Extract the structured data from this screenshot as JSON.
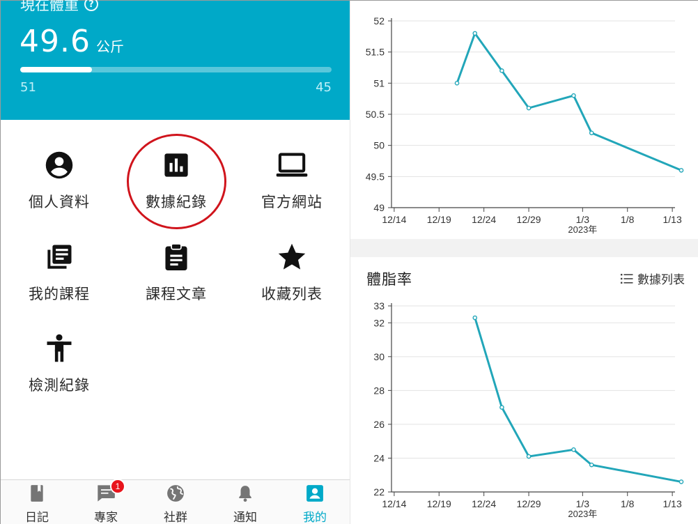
{
  "weight_card": {
    "title": "現在體重",
    "value": "49.6",
    "unit": "公斤",
    "start_value": "51",
    "goal_value": "45",
    "progress_fraction": 0.23
  },
  "menu": {
    "items": [
      {
        "label": "個人資料",
        "icon": "account-circle-icon"
      },
      {
        "label": "數據紀錄",
        "icon": "bar-chart-icon"
      },
      {
        "label": "官方網站",
        "icon": "laptop-icon"
      },
      {
        "label": "我的課程",
        "icon": "library-books-icon"
      },
      {
        "label": "課程文章",
        "icon": "clipboard-icon"
      },
      {
        "label": "收藏列表",
        "icon": "star-icon"
      },
      {
        "label": "檢測紀錄",
        "icon": "accessibility-icon"
      }
    ]
  },
  "tabbar": {
    "tabs": [
      {
        "label": "日記",
        "icon": "book-icon"
      },
      {
        "label": "專家",
        "icon": "chat-icon",
        "badge": "1"
      },
      {
        "label": "社群",
        "icon": "globe-icon"
      },
      {
        "label": "通知",
        "icon": "bell-icon"
      },
      {
        "label": "我的",
        "icon": "person-box-icon",
        "active": true
      }
    ]
  },
  "body_fat_section": {
    "title": "體脂率",
    "data_list_label": "數據列表"
  },
  "colors": {
    "accent": "#00a9c8",
    "chart_line": "#22a6b9",
    "highlight": "#d0141c",
    "badge": "#e8141c"
  },
  "chart_data": [
    {
      "type": "line",
      "title": "",
      "x": [
        "12/21",
        "12/23",
        "12/26",
        "12/29",
        "1/2",
        "1/4",
        "1/14"
      ],
      "series": [
        {
          "values": [
            51.0,
            51.8,
            51.2,
            50.6,
            50.8,
            50.2,
            49.6
          ]
        }
      ],
      "x_ticks": [
        "12/14",
        "12/19",
        "12/24",
        "12/29",
        "1/3",
        "1/8",
        "1/13"
      ],
      "x_year_label": "2023年",
      "y_ticks": [
        "49",
        "49.5",
        "50",
        "50.5",
        "51",
        "51.5",
        "52"
      ],
      "ylim": [
        49,
        52
      ],
      "grid": true
    },
    {
      "type": "line",
      "title": "體脂率",
      "x": [
        "12/23",
        "12/26",
        "12/29",
        "1/2",
        "1/4",
        "1/14"
      ],
      "series": [
        {
          "values": [
            32.3,
            27.0,
            24.1,
            24.5,
            23.6,
            22.6
          ]
        }
      ],
      "x_ticks": [
        "12/14",
        "12/19",
        "12/24",
        "12/29",
        "1/3",
        "1/8",
        "1/13"
      ],
      "x_year_label": "2023年",
      "y_ticks": [
        "22",
        "24",
        "26",
        "28",
        "30",
        "32",
        "33"
      ],
      "ylim": [
        22,
        33
      ],
      "grid": true
    }
  ]
}
